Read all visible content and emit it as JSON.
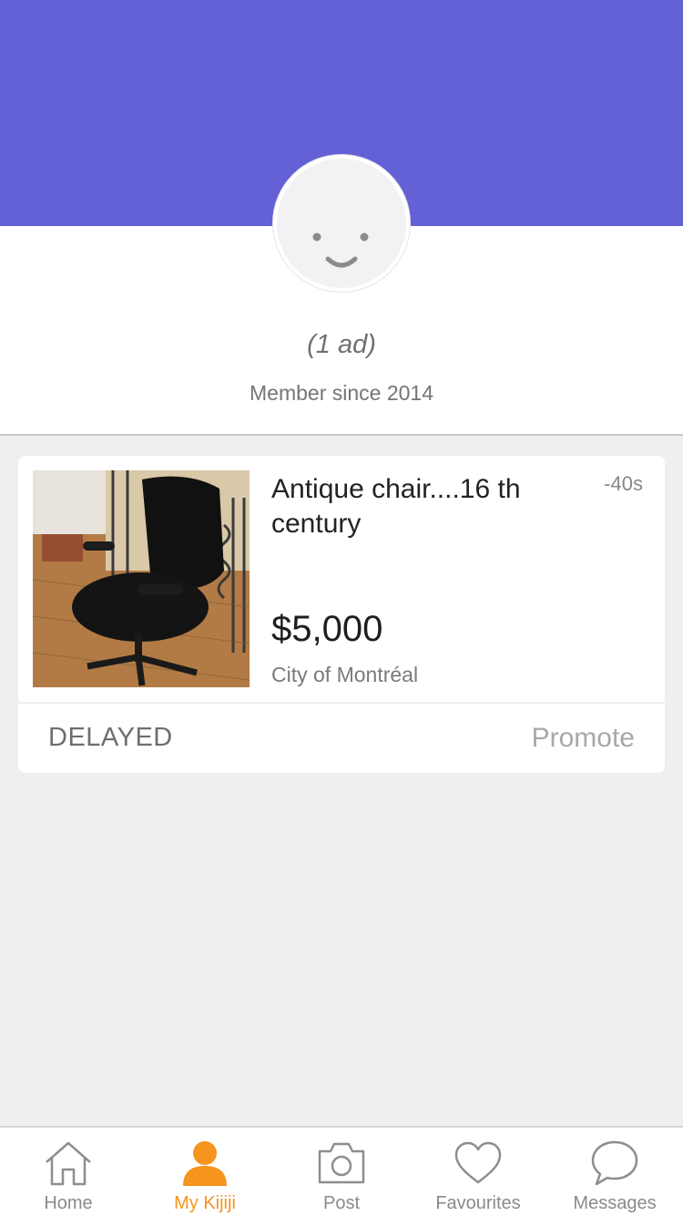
{
  "colors": {
    "header": "#6460d6",
    "accent": "#f5951d",
    "background": "#efefef"
  },
  "profile": {
    "avatar_icon": "smiley-face-icon",
    "ad_count": "(1 ad)",
    "member_since": "Member since 2014"
  },
  "ad": {
    "title": "Antique chair....16 th century",
    "time": "-40s",
    "price": "$5,000",
    "location": "City of Montréal",
    "status": "DELAYED",
    "promote_label": "Promote",
    "image_icon": "office-chair-photo"
  },
  "tabs": [
    {
      "label": "Home",
      "icon": "home-icon",
      "active": false
    },
    {
      "label": "My Kijiji",
      "icon": "person-icon",
      "active": true
    },
    {
      "label": "Post",
      "icon": "camera-icon",
      "active": false
    },
    {
      "label": "Favourites",
      "icon": "heart-icon",
      "active": false
    },
    {
      "label": "Messages",
      "icon": "chat-bubble-icon",
      "active": false
    }
  ]
}
